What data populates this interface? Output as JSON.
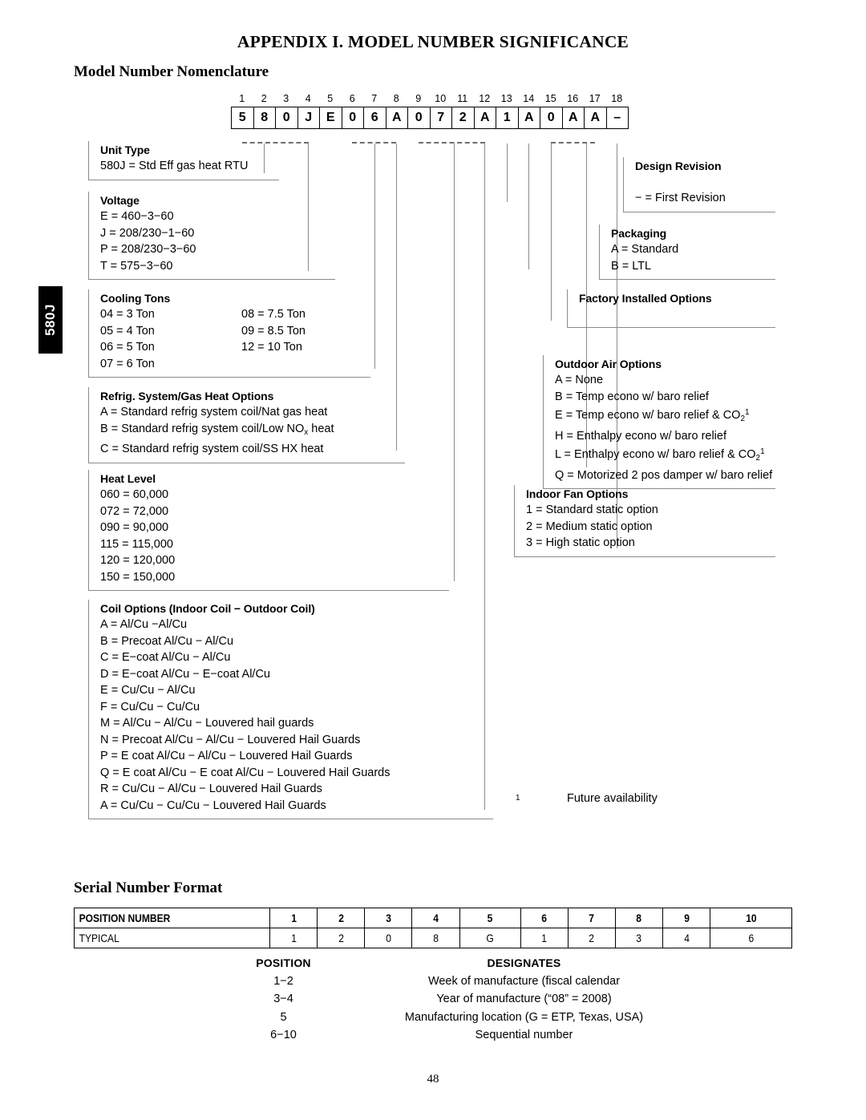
{
  "page": {
    "appendix_title": "APPENDIX I. MODEL NUMBER SIGNIFICANCE",
    "nomenclature_heading": "Model Number Nomenclature",
    "serial_heading": "Serial Number Format",
    "page_number": "48",
    "side_tab_label": "580J"
  },
  "model_grid": {
    "positions": [
      "1",
      "2",
      "3",
      "4",
      "5",
      "6",
      "7",
      "8",
      "9",
      "10",
      "11",
      "12",
      "13",
      "14",
      "15",
      "16",
      "17",
      "18"
    ],
    "characters": [
      "5",
      "8",
      "0",
      "J",
      "E",
      "0",
      "6",
      "A",
      "0",
      "7",
      "2",
      "A",
      "1",
      "A",
      "0",
      "A",
      "A",
      "–"
    ]
  },
  "sections": {
    "unit_type": {
      "title": "Unit Type",
      "rows": [
        "580J = Std Eff gas heat RTU"
      ]
    },
    "voltage": {
      "title": "Voltage",
      "rows": [
        "E = 460−3−60",
        "J = 208/230−1−60",
        "P = 208/230−3−60",
        "T = 575−3−60"
      ]
    },
    "cooling_tons": {
      "title": "Cooling Tons",
      "col_a": [
        "04 = 3 Ton",
        "05 = 4 Ton",
        "06 = 5 Ton",
        "07 = 6 Ton"
      ],
      "col_b": [
        "08 = 7.5 Ton",
        "09 = 8.5 Ton",
        "12 = 10 Ton"
      ]
    },
    "refrig_system": {
      "title": "Refrig. System/Gas Heat Options",
      "rows": [
        "A = Standard refrig system coil/Nat gas heat",
        "C = Standard refrig system coil/SS HX heat"
      ],
      "row_nox_prefix": "B = Standard refrig system coil/Low NO",
      "row_nox_sub": "x",
      "row_nox_suffix": " heat"
    },
    "heat_level": {
      "title": "Heat Level",
      "rows": [
        "060 = 60,000",
        "072 = 72,000",
        "090 = 90,000",
        "115 = 115,000",
        "120 = 120,000",
        "150 = 150,000"
      ]
    },
    "coil_options": {
      "title": "Coil Options (Indoor Coil − Outdoor Coil)",
      "rows": [
        "A = Al/Cu −Al/Cu",
        "B = Precoat Al/Cu − Al/Cu",
        "C = E−coat Al/Cu − Al/Cu",
        "D = E−coat Al/Cu − E−coat Al/Cu",
        "E = Cu/Cu − Al/Cu",
        "F = Cu/Cu − Cu/Cu",
        "M = Al/Cu − Al/Cu − Louvered hail guards",
        "N = Precoat Al/Cu − Al/Cu − Louvered Hail Guards",
        "P = E coat Al/Cu − Al/Cu − Louvered Hail Guards",
        "Q = E coat Al/Cu − E coat Al/Cu − Louvered Hail Guards",
        "R = Cu/Cu − Al/Cu − Louvered Hail Guards",
        "A = Cu/Cu − Cu/Cu − Louvered Hail Guards"
      ]
    },
    "design_revision": {
      "title": "Design Revision",
      "rows": [
        "− = First Revision"
      ]
    },
    "packaging": {
      "title": "Packaging",
      "rows": [
        "A = Standard",
        "B = LTL"
      ]
    },
    "factory_installed_options": {
      "title": "Factory Installed Options",
      "rows": []
    },
    "outdoor_air_options": {
      "title": "Outdoor Air Options",
      "rows_plain_1": [
        "A = None",
        "B = Temp econo w/ baro relief"
      ],
      "row_e_prefix": "E = Temp econo w/ baro relief & CO",
      "row_h": "H = Enthalpy econo w/ baro relief",
      "row_l_prefix": "L = Enthalpy econo w/ baro relief & CO",
      "row_q": "Q = Motorized 2 pos damper w/ baro relief",
      "co2_sub": "2",
      "co2_sup": "1"
    },
    "indoor_fan_options": {
      "title": "Indoor Fan Options",
      "rows": [
        "1 = Standard static option",
        "2 = Medium static option",
        "3 = High static option"
      ]
    }
  },
  "footnote": {
    "mark": "1",
    "text": "Future availability"
  },
  "serial_table": {
    "row_header_label": "POSITION NUMBER",
    "row_header_values": [
      "1",
      "2",
      "3",
      "4",
      "5",
      "6",
      "7",
      "8",
      "9",
      "10"
    ],
    "row_typical_label": "TYPICAL",
    "row_typical_values": [
      "1",
      "2",
      "0",
      "8",
      "G",
      "1",
      "2",
      "3",
      "4",
      "6"
    ]
  },
  "position_table": {
    "headers": [
      "POSITION",
      "DESIGNATES"
    ],
    "rows": [
      [
        "1−2",
        "Week of manufacture (fiscal calendar"
      ],
      [
        "3−4",
        "Year of manufacture (“08” = 2008)"
      ],
      [
        "5",
        "Manufacturing location (G = ETP, Texas, USA)"
      ],
      [
        "6−10",
        "Sequential number"
      ]
    ]
  }
}
